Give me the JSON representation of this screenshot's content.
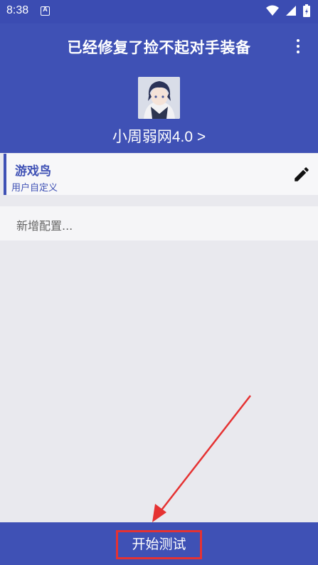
{
  "status_bar": {
    "time": "8:38",
    "notification_letter": "A",
    "icons": [
      "wifi-icon",
      "signal-icon",
      "battery-icon"
    ]
  },
  "header": {
    "title": "已经修复了捡不起对手装备",
    "subtitle": "小周弱网4.0 >",
    "menu_icon": "more-vert-icon"
  },
  "config_card": {
    "name": "游戏鸟",
    "type": "用户自定义",
    "edit_icon": "pencil-icon"
  },
  "add_config": {
    "label": "新增配置..."
  },
  "bottom_bar": {
    "start_label": "开始测试"
  },
  "colors": {
    "primary": "#3f51b5",
    "status_bar": "#3b4cb2",
    "background": "#e9e9ee",
    "annotation_red": "#e53232"
  }
}
